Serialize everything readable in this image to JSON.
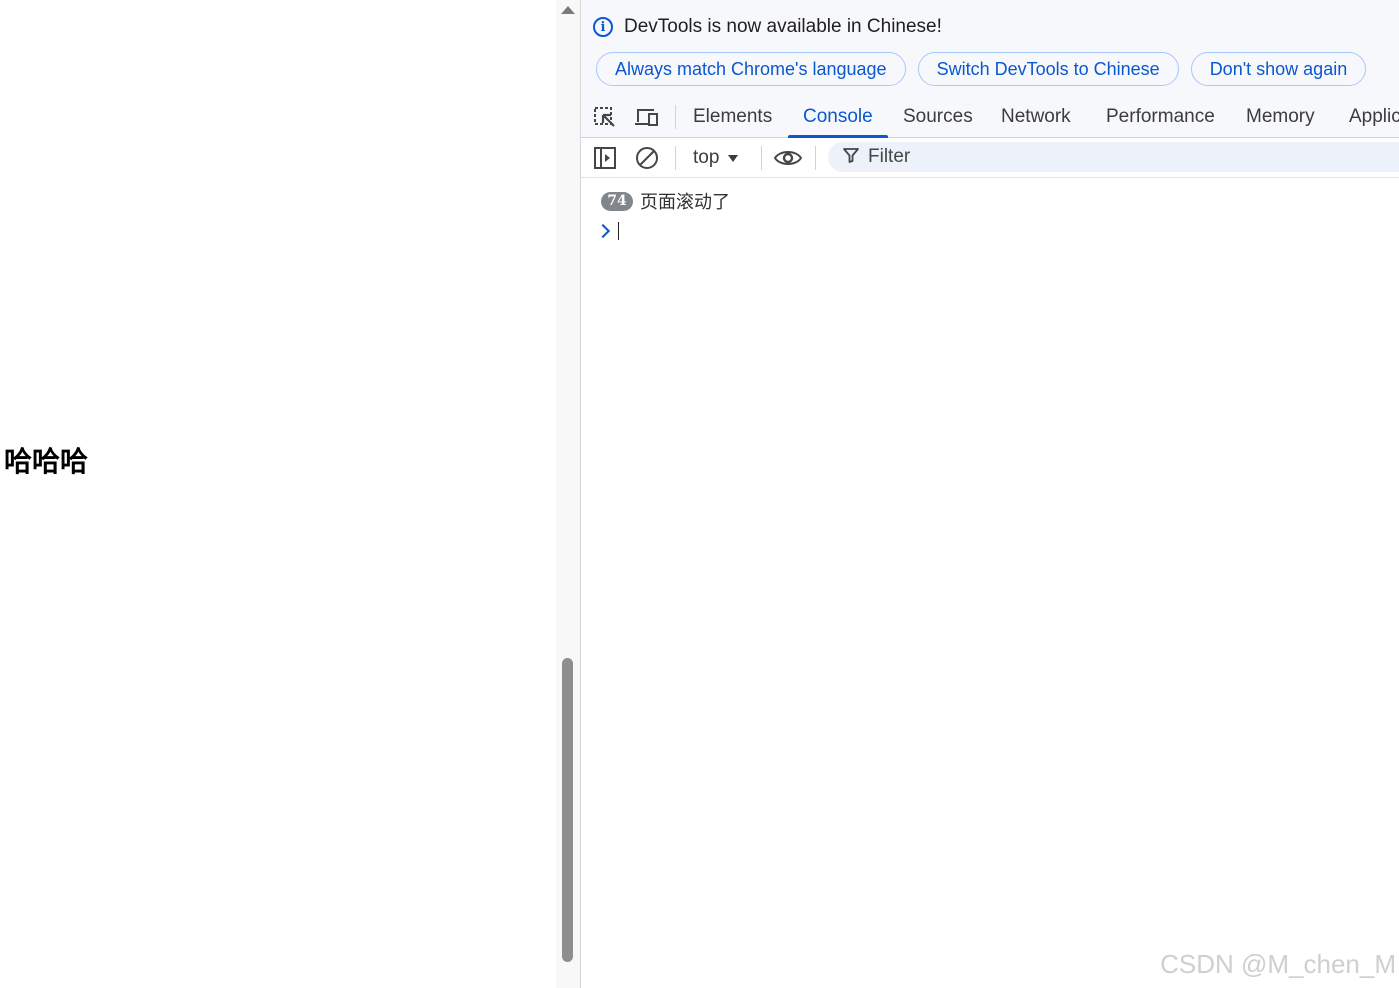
{
  "page": {
    "heading": "哈哈哈"
  },
  "devtools": {
    "infobar": {
      "message": "DevTools is now available in Chinese!",
      "buttons": [
        "Always match Chrome's language",
        "Switch DevTools to Chinese",
        "Don't show again"
      ]
    },
    "tabs": [
      "Elements",
      "Console",
      "Sources",
      "Network",
      "Performance",
      "Memory",
      "Applic"
    ],
    "active_tab": "Console",
    "toolbar": {
      "context": "top",
      "filter_placeholder": "Filter"
    },
    "console": {
      "messages": [
        {
          "count": "74",
          "text": "页面滚动了"
        }
      ]
    },
    "colors": {
      "accent": "#0b57d0",
      "badge": "#80868b"
    }
  },
  "watermark": "CSDN @M_chen_M"
}
